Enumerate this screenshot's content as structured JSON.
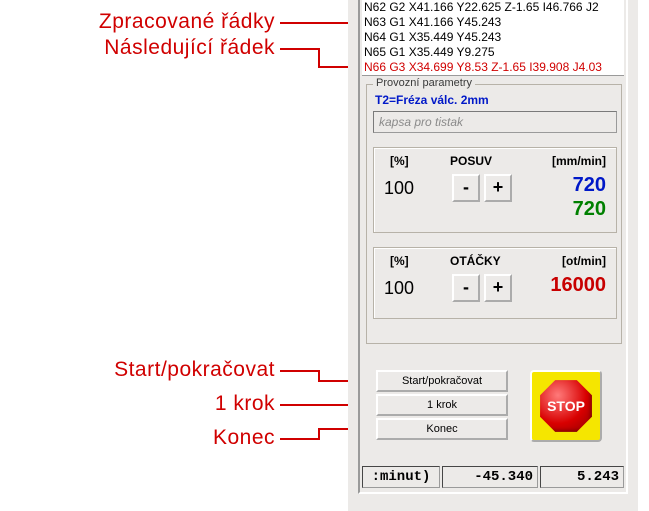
{
  "callouts": {
    "processed_rows": "Zpracované řádky",
    "next_row": "Následující řádek",
    "start_continue": "Start/pokračovat",
    "one_step": "1 krok",
    "end": "Konec"
  },
  "code": {
    "lines": [
      "N62 G2 X41.166 Y22.625 Z-1.65 I46.766 J2",
      "N63 G1 X41.166 Y45.243",
      "N64 G1 X35.449 Y45.243",
      "N65 G1 X35.449 Y9.275"
    ],
    "current": "N66 G3 X34.699 Y8.53 Z-1.65 I39.908 J4.03"
  },
  "group": {
    "title": "Provozní parametry",
    "tool": "T2=Fréza válc. 2mm",
    "desc": "kapsa pro tistak"
  },
  "feed": {
    "pct_hdr": "[%]",
    "name": "POSUV",
    "unit": "[mm/min]",
    "pct": "100",
    "minus": "-",
    "plus": "+",
    "value": "720",
    "value2": "720"
  },
  "speed": {
    "pct_hdr": "[%]",
    "name": "OTÁČKY",
    "unit": "[ot/min]",
    "pct": "100",
    "minus": "-",
    "plus": "+",
    "value": "16000"
  },
  "buttons": {
    "start": "Start/pokračovat",
    "step": "1 krok",
    "end": "Konec",
    "stop": "STOP"
  },
  "footer": {
    "c1": ":minut)",
    "c2": "-45.340",
    "c3": "5.243"
  }
}
